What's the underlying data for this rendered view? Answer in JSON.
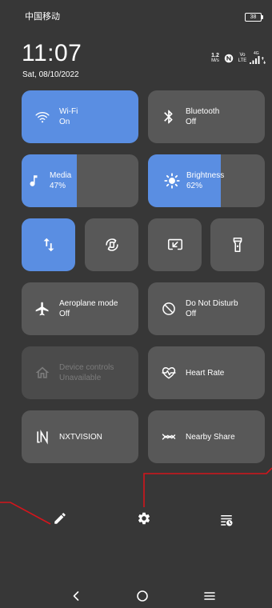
{
  "status_bar": {
    "carrier": "中国移动",
    "battery_text": "38",
    "battery_icon": "battery-icon"
  },
  "header": {
    "time": "11:07",
    "date": "Sat, 08/10/2022",
    "net_speed": {
      "value": "1.2",
      "unit": "M/s"
    },
    "nfc_icon": "nfc-icon",
    "volte": {
      "top": "Vo",
      "bottom": "LTE"
    },
    "signal": {
      "network": "4G",
      "icon": "signal-bars-icon"
    },
    "data_activity_icon": "data-arrows-icon"
  },
  "tiles": {
    "wifi": {
      "label": "Wi-Fi",
      "state": "On",
      "icon": "wifi-icon",
      "active": true
    },
    "bluetooth": {
      "label": "Bluetooth",
      "state": "Off",
      "icon": "bluetooth-icon",
      "active": false
    },
    "aeroplane": {
      "label": "Aeroplane mode",
      "state": "Off",
      "icon": "airplane-icon",
      "active": false
    },
    "dnd": {
      "label": "Do Not Disturb",
      "state": "Off",
      "icon": "do-not-disturb-icon",
      "active": false
    },
    "device_controls": {
      "label": "Device controls",
      "state": "Unavailable",
      "icon": "home-icon",
      "enabled": false
    },
    "heart_rate": {
      "label": "Heart Rate",
      "icon": "heart-rate-icon"
    },
    "nxtvision": {
      "label": "NXTVISION",
      "icon": "nxtvision-icon"
    },
    "nearby_share": {
      "label": "Nearby Share",
      "icon": "nearby-share-icon"
    }
  },
  "sliders": {
    "media": {
      "label": "Media",
      "value_text": "47%",
      "level": 0.47,
      "icon": "music-note-icon"
    },
    "brightness": {
      "label": "Brightness",
      "value_text": "62%",
      "level": 0.62,
      "icon": "brightness-icon"
    }
  },
  "quick_toggles": [
    {
      "icon": "mobile-data-icon",
      "active": true
    },
    {
      "icon": "auto-rotate-icon",
      "active": false
    },
    {
      "icon": "screen-cast-icon",
      "active": false
    },
    {
      "icon": "flashlight-icon",
      "active": false
    }
  ],
  "bottom_actions": {
    "edit_icon": "pencil-icon",
    "settings_icon": "gear-icon",
    "alarm_list_icon": "alarm-list-icon"
  },
  "nav_bar": {
    "back_icon": "back-icon",
    "home_icon": "home-circle-icon",
    "recents_icon": "recents-icon"
  },
  "colors": {
    "background": "#373737",
    "tile": "#585858",
    "tile_disabled": "#4b4b4b",
    "accent": "#5a8ee2",
    "text": "#ffffff",
    "disabled_text": "#7b7b7b",
    "annotation": "#d4151c"
  }
}
